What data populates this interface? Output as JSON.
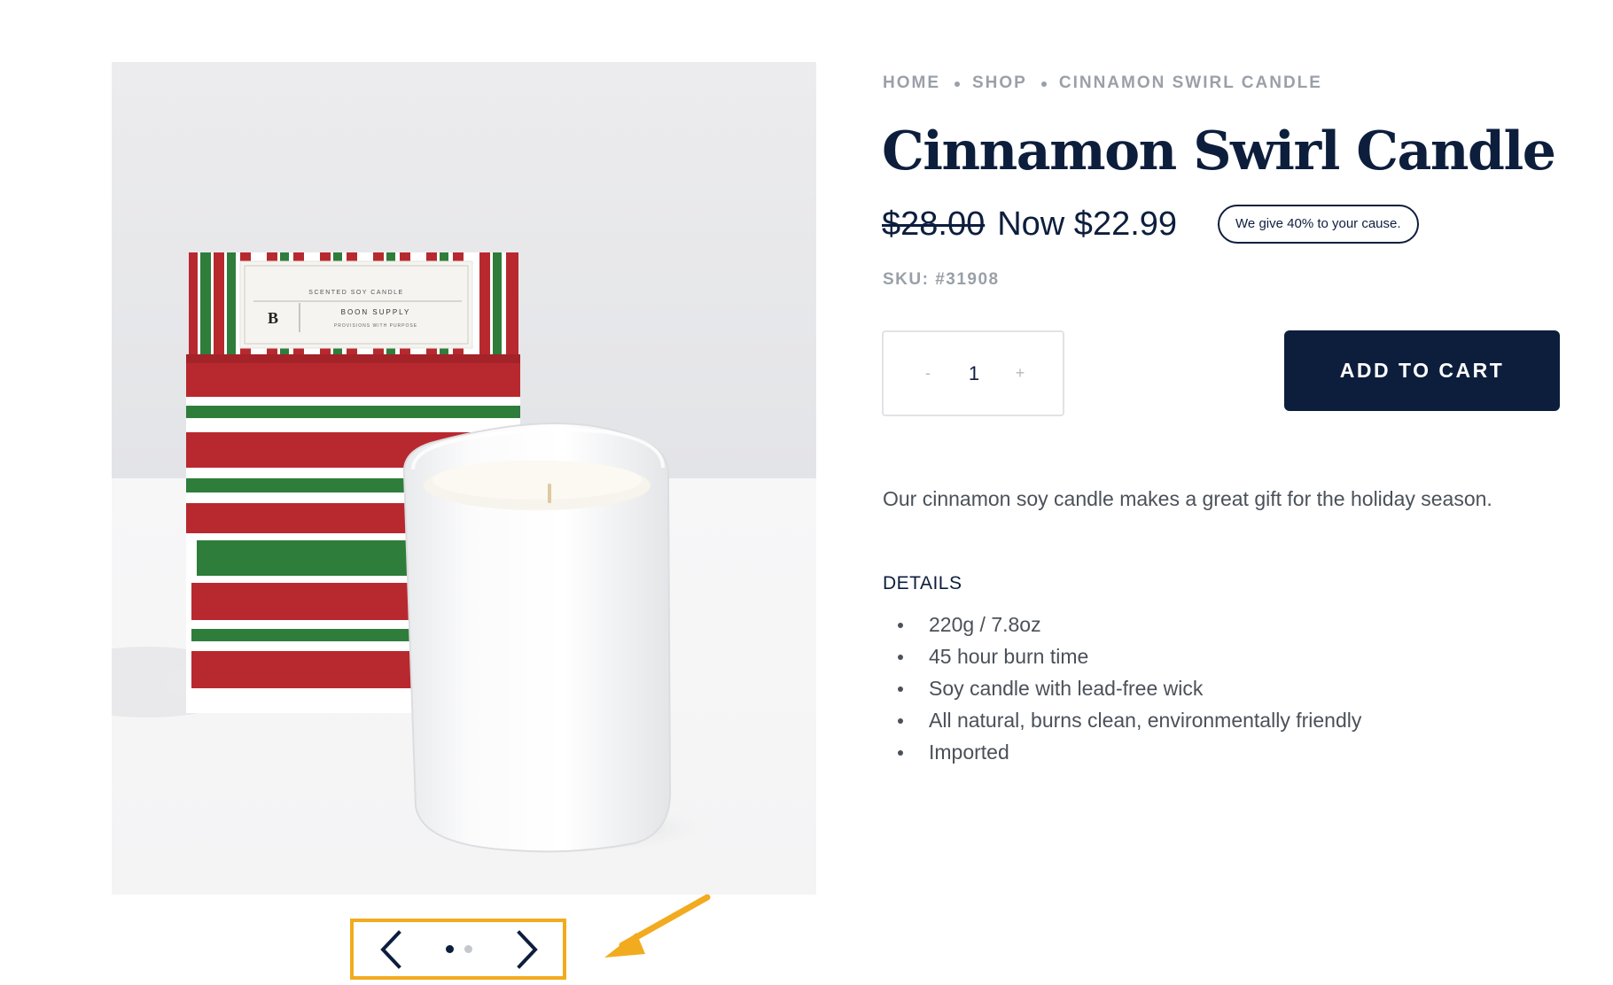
{
  "product_image": {
    "label_brand": "B",
    "label_name": "BOON SUPPLY",
    "label_type": "SCENTED SOY CANDLE",
    "label_tagline": "PROVISIONS WITH PURPOSE"
  },
  "carousel": {
    "prev_icon": "chevron-left-icon",
    "next_icon": "chevron-right-icon",
    "slide_count": 2,
    "active_slide": 1,
    "highlight_color": "#f2ab1f"
  },
  "breadcrumb": {
    "items": [
      "HOME",
      "SHOP",
      "CINNAMON SWIRL CANDLE"
    ]
  },
  "product": {
    "title": "Cinnamon Swirl Candle",
    "old_price": "$28.00",
    "new_price": "Now $22.99",
    "cause_text": "We give 40% to your cause.",
    "sku": "SKU: #31908",
    "description": "Our cinnamon soy candle makes a great gift for the holiday season."
  },
  "quantity": {
    "minus_label": "-",
    "value": "1",
    "plus_label": "+"
  },
  "add_to_cart_label": "ADD TO CART",
  "details": {
    "heading": "DETAILS",
    "items": [
      "220g / 7.8oz",
      "45 hour burn time",
      "Soy candle with lead-free wick",
      "All natural, burns clean, environmentally friendly",
      "Imported"
    ]
  },
  "colors": {
    "navy": "#0d1e3d",
    "muted_gray": "#9aa0a8",
    "box_red": "#b8292f",
    "box_green": "#2e7d3a",
    "annotation_orange": "#f2ab1f"
  }
}
